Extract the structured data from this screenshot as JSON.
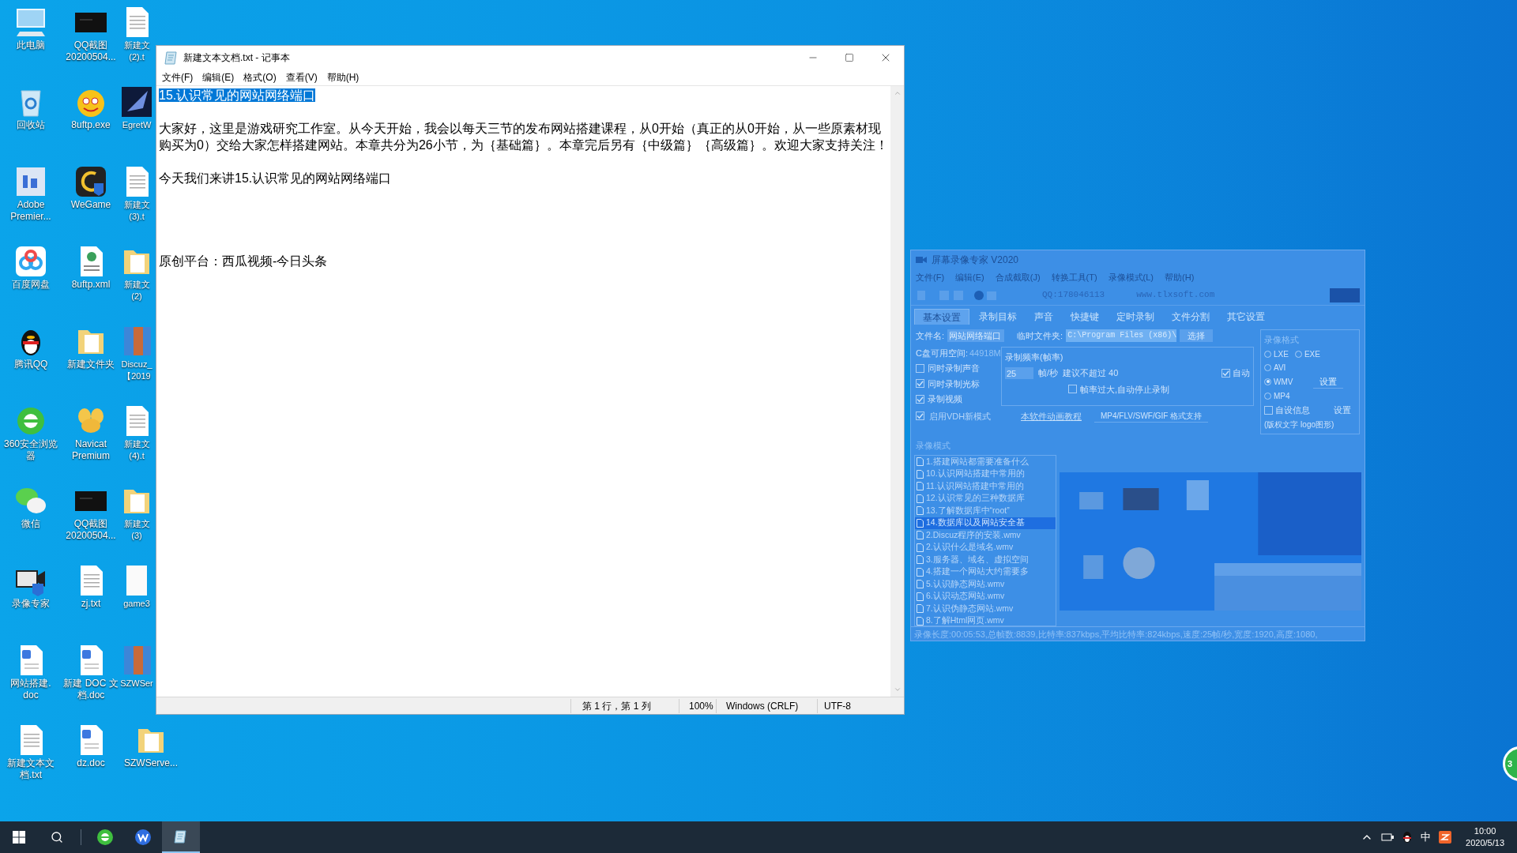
{
  "desktop": {
    "columns": [
      [
        {
          "kind": "computer",
          "label_lines": [
            "此电脑"
          ]
        },
        {
          "kind": "recycle",
          "label_lines": [
            "回收站"
          ]
        },
        {
          "kind": "premiere",
          "label_lines": [
            "Adobe",
            "Premier..."
          ]
        },
        {
          "kind": "cloud",
          "label_lines": [
            "百度网盘"
          ]
        },
        {
          "kind": "qq",
          "label_lines": [
            "腾讯QQ"
          ]
        },
        {
          "kind": "browser",
          "label_lines": [
            "360安全浏览",
            "器"
          ]
        },
        {
          "kind": "wechat",
          "label_lines": [
            "微信"
          ]
        },
        {
          "kind": "recorder",
          "label_lines": [
            "录像专家"
          ]
        },
        {
          "kind": "word",
          "label_lines": [
            "网站搭建.",
            "doc"
          ]
        },
        {
          "kind": "document",
          "label_lines": [
            "新建文本文",
            "档.txt"
          ]
        }
      ],
      [
        {
          "kind": "screenshot",
          "label_lines": [
            "QQ截图",
            "20200504..."
          ]
        },
        {
          "kind": "ftp",
          "label_lines": [
            "8uftp.exe"
          ]
        },
        {
          "kind": "wegame",
          "label_lines": [
            "WeGame"
          ]
        },
        {
          "kind": "xml",
          "label_lines": [
            "8uftp.xml"
          ]
        },
        {
          "kind": "folder",
          "label_lines": [
            "新建文件夹"
          ]
        },
        {
          "kind": "navicat",
          "label_lines": [
            "Navicat",
            "Premium"
          ]
        },
        {
          "kind": "screenshot",
          "label_lines": [
            "QQ截图",
            "20200504..."
          ]
        },
        {
          "kind": "document",
          "label_lines": [
            "zj.txt"
          ]
        },
        {
          "kind": "word",
          "label_lines": [
            "新建 DOC 文",
            "档.doc"
          ]
        },
        {
          "kind": "word",
          "label_lines": [
            "dz.doc"
          ]
        }
      ],
      [
        {
          "kind": "document",
          "label_lines": [
            "新建文",
            "(2).t"
          ]
        },
        {
          "kind": "egret",
          "label_lines": [
            "EgretW"
          ]
        },
        {
          "kind": "document",
          "label_lines": [
            "新建文",
            "(3).t"
          ]
        },
        {
          "kind": "folder",
          "label_lines": [
            "新建文",
            "(2)"
          ]
        },
        {
          "kind": "archive",
          "label_lines": [
            "Discuz_",
            "【2019"
          ]
        },
        {
          "kind": "document",
          "label_lines": [
            "新建文",
            "(4).t"
          ]
        },
        {
          "kind": "folder",
          "label_lines": [
            "新建文",
            "(3)"
          ]
        },
        {
          "kind": "blank",
          "label_lines": [
            "game3"
          ]
        },
        {
          "kind": "archive",
          "label_lines": [
            "SZWSer"
          ]
        },
        {
          "kind": "folder",
          "label_lines": [
            "SZWServe..."
          ]
        }
      ]
    ]
  },
  "notepad": {
    "title": "新建文本文档.txt - 记事本",
    "menu": [
      "文件(F)",
      "编辑(E)",
      "格式(O)",
      "查看(V)",
      "帮助(H)"
    ],
    "selected_text": "15.认识常见的网站网络端口",
    "lines": [
      {
        "kind": "blank"
      },
      {
        "kind": "text",
        "text": "大家好，这里是游戏研究工作室。从今天开始，我会以每天三节的发布网站搭建课程，从0开始（真正的从0开始，从一些原素材现"
      },
      {
        "kind": "text",
        "text": "购买为0）交给大家怎样搭建网站。本章共分为26小节，为｛基础篇｝。本章完后另有｛中级篇｝｛高级篇｝。欢迎大家支持关注！"
      },
      {
        "kind": "blank"
      },
      {
        "kind": "text",
        "text": "今天我们来讲15.认识常见的网站网络端口"
      },
      {
        "kind": "blank"
      },
      {
        "kind": "blank"
      },
      {
        "kind": "blank"
      },
      {
        "kind": "blank"
      },
      {
        "kind": "text",
        "text": "原创平台：西瓜视频-今日头条"
      }
    ],
    "status": [
      "第 1 行，第 1 列",
      "100%",
      "Windows (CRLF)",
      "UTF-8"
    ]
  },
  "recorder": {
    "title": "屏幕录像专家 V2020",
    "menu": [
      "文件(F)",
      "编辑(E)",
      "合成截取(J)",
      "转换工具(T)",
      "录像模式(L)",
      "帮助(H)"
    ],
    "toolbar_texts": [
      "QQ:178046113",
      "www.tlxsoft.com"
    ],
    "tabs": [
      {
        "label": "基本设置",
        "selected": true
      },
      {
        "label": "录制目标",
        "selected": false
      },
      {
        "label": "声音",
        "selected": false
      },
      {
        "label": "快捷键",
        "selected": false
      },
      {
        "label": "定时录制",
        "selected": false
      },
      {
        "label": "文件分割",
        "selected": false
      },
      {
        "label": "其它设置",
        "selected": false
      }
    ],
    "file_name_label": "文件名:",
    "file_name": "网站网络端口",
    "temp_folder_label": "临时文件夹:",
    "temp_folder": "C:\\Program Files (x86)\\",
    "choose_button": "选择",
    "disk_label": "C盘可用空间:",
    "disk_value": "44918M",
    "options": [
      {
        "label": "同时录制声音",
        "checked": false
      },
      {
        "label": "同时录制光标",
        "checked": true
      },
      {
        "label": "录制视频",
        "checked": true
      }
    ],
    "frame_group": "录制频率(帧率)",
    "fps": "25",
    "fps_unit": "帧/秒",
    "fps_hint": "建议不超过 40",
    "auto": {
      "label": "自动",
      "checked": true
    },
    "auto_stop": {
      "label": "帧率过大,自动停止录制",
      "checked": false
    },
    "new_mode": {
      "label": "启用VDH新模式",
      "checked": true
    },
    "tutorial_link": "本软件动画教程",
    "formats_button": "MP4/FLV/SWF/GIF 格式支持",
    "format_group": "录像格式",
    "formats": [
      {
        "label": "LXE",
        "selected": false
      },
      {
        "label": "EXE",
        "selected": false
      },
      {
        "label": "AVI",
        "selected": false
      },
      {
        "label": "WMV",
        "selected": true
      },
      {
        "label": "MP4",
        "selected": false
      }
    ],
    "settings_button": "设置",
    "custom_info": {
      "label": "自设信息",
      "checked": false
    },
    "custom_button": "设置",
    "custom_hint": "(版权文字 logo图形)",
    "mode_label": "录像模式",
    "files": [
      {
        "name": "1.搭建网站都需要准备什么",
        "selected": false
      },
      {
        "name": "10.认识网站搭建中常用的",
        "selected": false
      },
      {
        "name": "11.认识网站搭建中常用的",
        "selected": false
      },
      {
        "name": "12.认识常见的三种数据库",
        "selected": false
      },
      {
        "name": "13.了解数据库中“root”",
        "selected": false
      },
      {
        "name": "14.数据库以及网站安全基",
        "selected": true
      },
      {
        "name": "2.Discuz程序的安装.wmv",
        "selected": false
      },
      {
        "name": "2.认识什么是域名.wmv",
        "selected": false
      },
      {
        "name": "3.服务器、域名、虚拟空间",
        "selected": false
      },
      {
        "name": "4.搭建一个网站大约需要多",
        "selected": false
      },
      {
        "name": "5.认识静态网站.wmv",
        "selected": false
      },
      {
        "name": "6.认识动态网站.wmv",
        "selected": false
      },
      {
        "name": "7.认识伪静态网站.wmv",
        "selected": false
      },
      {
        "name": "8.了解Html网页.wmv",
        "selected": false
      }
    ],
    "status": "录像长度:00:05:53,总帧数:8839,比特率:837kbps,平均比特率:824kbps,速度:25帧/秒,宽度:1920,高度:1080,"
  },
  "widget": {
    "text": "3"
  },
  "taskbar": {
    "apps": [
      {
        "kind": "browser",
        "active": false
      },
      {
        "kind": "wps",
        "active": false
      },
      {
        "kind": "notepad",
        "active": true
      }
    ],
    "ime": "中",
    "time": "10:00",
    "date": "2020/5/13"
  }
}
